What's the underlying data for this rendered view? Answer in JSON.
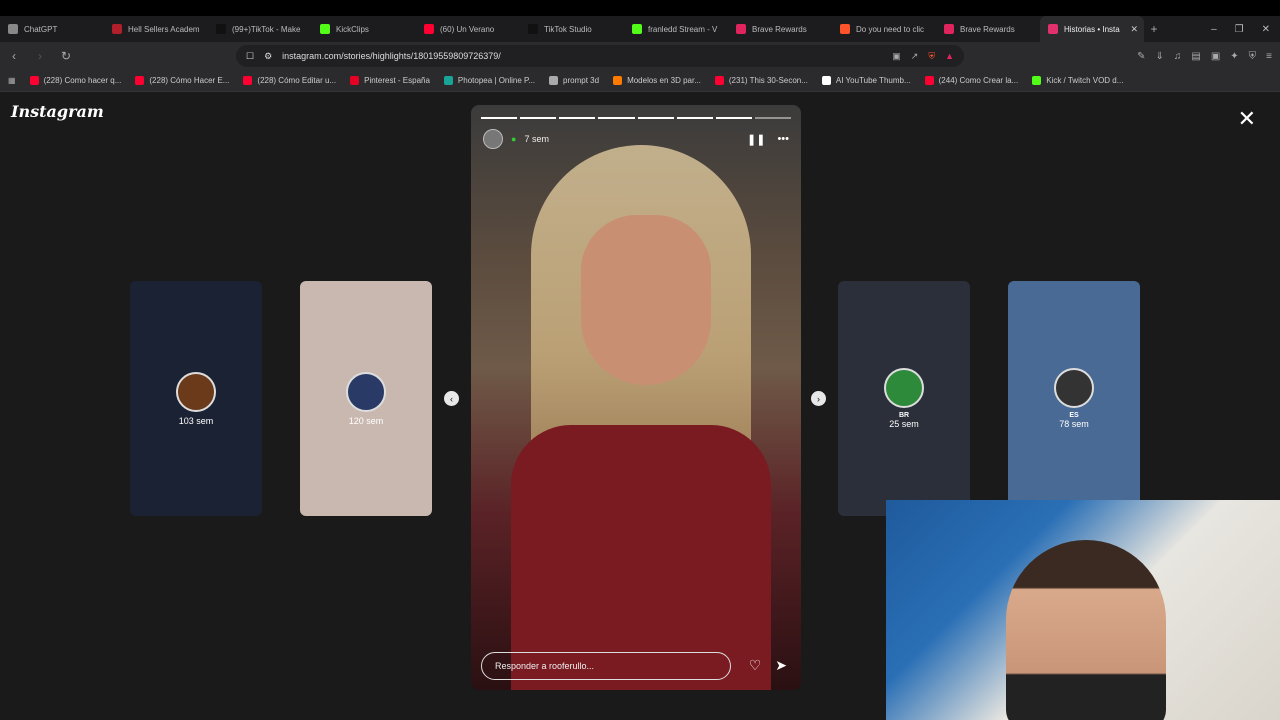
{
  "browser": {
    "tabs": [
      {
        "label": "ChatGPT",
        "color": "#888888"
      },
      {
        "label": "Hell Sellers Academ",
        "color": "#b11f2b"
      },
      {
        "label": "(99+)TikTok - Make",
        "color": "#111111"
      },
      {
        "label": "KickClips",
        "color": "#53fc18"
      },
      {
        "label": "(60) Un Verano",
        "color": "#ff0033"
      },
      {
        "label": "TikTok Studio",
        "color": "#111111"
      },
      {
        "label": "franledd Stream - V",
        "color": "#53fc18"
      },
      {
        "label": "Brave Rewards",
        "color": "#e0245e"
      },
      {
        "label": "Do you need to clic",
        "color": "#fb542b"
      },
      {
        "label": "Brave Rewards",
        "color": "#e0245e"
      },
      {
        "label": "Historias • Insta",
        "color": "#e1306c"
      }
    ],
    "new_tab_symbol": "+",
    "url": "instagram.com/stories/highlights/18019559809726379/",
    "bookmarks": [
      {
        "label": "(228) Como hacer q...",
        "color": "#ff0033"
      },
      {
        "label": "(228) Cómo Hacer E...",
        "color": "#ff0033"
      },
      {
        "label": "(228) Cómo Editar u...",
        "color": "#ff0033"
      },
      {
        "label": "Pinterest - España",
        "color": "#e60023"
      },
      {
        "label": "Photopea | Online P...",
        "color": "#18a497"
      },
      {
        "label": "prompt 3d",
        "color": "#aaaaaa"
      },
      {
        "label": "Modelos en 3D par...",
        "color": "#ff7a00"
      },
      {
        "label": "(231) This 30-Secon...",
        "color": "#ff0033"
      },
      {
        "label": "AI YouTube Thumb...",
        "color": "#ffffff"
      },
      {
        "label": "(244) Como Crear la...",
        "color": "#ff0033"
      },
      {
        "label": "Kick / Twitch VOD d...",
        "color": "#53fc18"
      }
    ]
  },
  "instagram": {
    "logo": "Instagram",
    "story": {
      "time": "7 sem",
      "reply_placeholder": "Responder a rooferullo...",
      "segments_total": 8,
      "segments_done": 7
    },
    "side_stories": [
      {
        "label": "103 sem",
        "name": "",
        "bg": "#1b2233"
      },
      {
        "label": "120 sem",
        "name": "",
        "bg": "#c9b8b0"
      },
      {
        "label": "25 sem",
        "name": "BR",
        "bg": "#2b2f3a"
      },
      {
        "label": "78 sem",
        "name": "ES",
        "bg": "#4a6a96"
      }
    ]
  }
}
